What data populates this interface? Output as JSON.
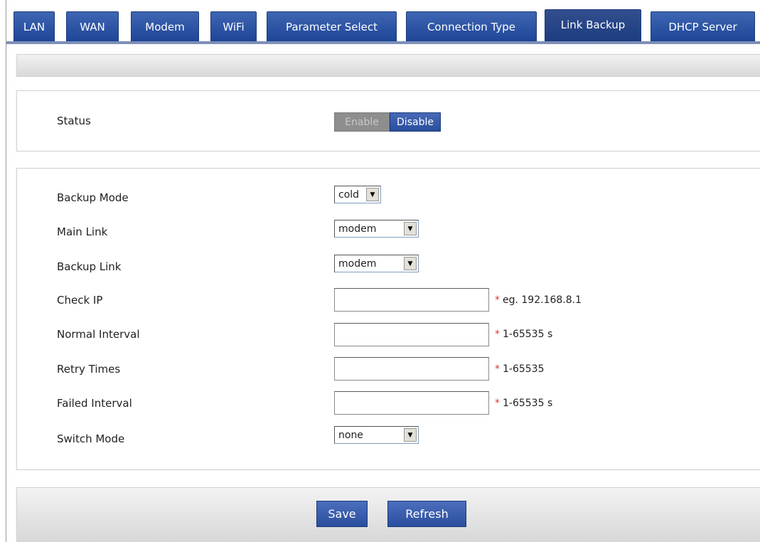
{
  "tabs": [
    {
      "label": "LAN"
    },
    {
      "label": "WAN"
    },
    {
      "label": "Modem"
    },
    {
      "label": "WiFi"
    },
    {
      "label": "Parameter Select"
    },
    {
      "label": "Connection Type"
    },
    {
      "label": "Link Backup",
      "active": true
    },
    {
      "label": "DHCP Server"
    }
  ],
  "status": {
    "label": "Status",
    "enable_label": "Enable",
    "disable_label": "Disable"
  },
  "form": {
    "backup_mode": {
      "label": "Backup Mode",
      "value": "cold"
    },
    "main_link": {
      "label": "Main Link",
      "value": "modem"
    },
    "backup_link": {
      "label": "Backup Link",
      "value": "modem"
    },
    "check_ip": {
      "label": "Check IP",
      "value": "",
      "hint": "eg. 192.168.8.1"
    },
    "normal_interval": {
      "label": "Normal Interval",
      "value": "",
      "hint": "1-65535 s"
    },
    "retry_times": {
      "label": "Retry Times",
      "value": "",
      "hint": "1-65535"
    },
    "failed_interval": {
      "label": "Failed Interval",
      "value": "",
      "hint": "1-65535 s"
    },
    "switch_mode": {
      "label": "Switch Mode",
      "value": "none"
    },
    "required_mark": "*"
  },
  "actions": {
    "save_label": "Save",
    "refresh_label": "Refresh"
  },
  "colors": {
    "tab_blue": "#2a4e9e",
    "required_red": "#e0343a"
  }
}
